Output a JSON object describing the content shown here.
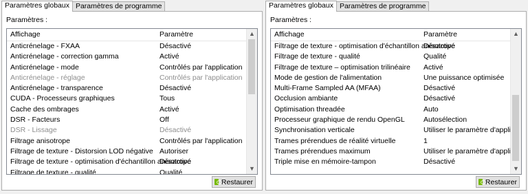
{
  "left": {
    "tabs": [
      "Paramètres globaux",
      "Paramètres de programme"
    ],
    "settings_label": "Paramètres :",
    "columns": [
      "Affichage",
      "Paramètre"
    ],
    "rows": [
      {
        "name": "Anticrénelage - FXAA",
        "value": "Désactivé",
        "disabled": false
      },
      {
        "name": "Anticrénelage - correction gamma",
        "value": "Activé",
        "disabled": false
      },
      {
        "name": "Anticrénelage - mode",
        "value": "Contrôlés par l'application",
        "disabled": false
      },
      {
        "name": "Anticrénelage - réglage",
        "value": "Contrôlés par l'application",
        "disabled": true
      },
      {
        "name": "Anticrénelage - transparence",
        "value": "Désactivé",
        "disabled": false
      },
      {
        "name": "CUDA - Processeurs graphiques",
        "value": "Tous",
        "disabled": false
      },
      {
        "name": "Cache des ombrages",
        "value": "Activé",
        "disabled": false
      },
      {
        "name": "DSR - Facteurs",
        "value": "Off",
        "disabled": false
      },
      {
        "name": "DSR - Lissage",
        "value": "Désactivé",
        "disabled": true
      },
      {
        "name": "Filtrage anisotrope",
        "value": "Contrôlés par l'application",
        "disabled": false
      },
      {
        "name": "Filtrage de texture - Distorsion LOD négative",
        "value": "Autoriser",
        "disabled": false
      },
      {
        "name": "Filtrage de texture - optimisation d'échantillon anisotrope",
        "value": "Désactivé",
        "disabled": false
      },
      {
        "name": "Filtrage de texture - qualité",
        "value": "Qualité",
        "disabled": false
      }
    ],
    "scroll_position": 0.0,
    "restore_label": "Restaurer"
  },
  "right": {
    "tabs": [
      "Paramètres globaux",
      "Paramètres de programme"
    ],
    "settings_label": "Paramètres :",
    "columns": [
      "Affichage",
      "Paramètre"
    ],
    "rows": [
      {
        "name": "Filtrage de texture - optimisation d'échantillon anisotrope",
        "value": "Désactivé",
        "disabled": false
      },
      {
        "name": "Filtrage de texture - qualité",
        "value": "Qualité",
        "disabled": false
      },
      {
        "name": "Filtrage de texture – optimisation trilinéaire",
        "value": "Activé",
        "disabled": false
      },
      {
        "name": "Mode de gestion de l'alimentation",
        "value": "Une puissance optimisée",
        "disabled": false
      },
      {
        "name": "Multi-Frame Sampled AA (MFAA)",
        "value": "Désactivé",
        "disabled": false
      },
      {
        "name": "Occlusion ambiante",
        "value": "Désactivé",
        "disabled": false
      },
      {
        "name": "Optimisation threadée",
        "value": "Auto",
        "disabled": false
      },
      {
        "name": "Processeur graphique de rendu OpenGL",
        "value": "Autosélection",
        "disabled": false
      },
      {
        "name": "Synchronisation verticale",
        "value": "Utiliser le paramètre d'applicat...",
        "disabled": false
      },
      {
        "name": "Trames prérendues de réalité virtuelle",
        "value": "1",
        "disabled": false
      },
      {
        "name": "Trames prérendues maximum",
        "value": "Utiliser le paramètre d'applicat...",
        "disabled": false
      },
      {
        "name": "Triple mise en mémoire-tampon",
        "value": "Désactivé",
        "disabled": false
      }
    ],
    "scroll_position": 1.0,
    "restore_label": "Restaurer"
  },
  "icons": {
    "scroll_up": "chevron-up-icon",
    "scroll_down": "chevron-down-icon",
    "restore": "nvidia-icon"
  },
  "colors": {
    "accent": "#76b900",
    "disabled_text": "#8d8d8d"
  }
}
